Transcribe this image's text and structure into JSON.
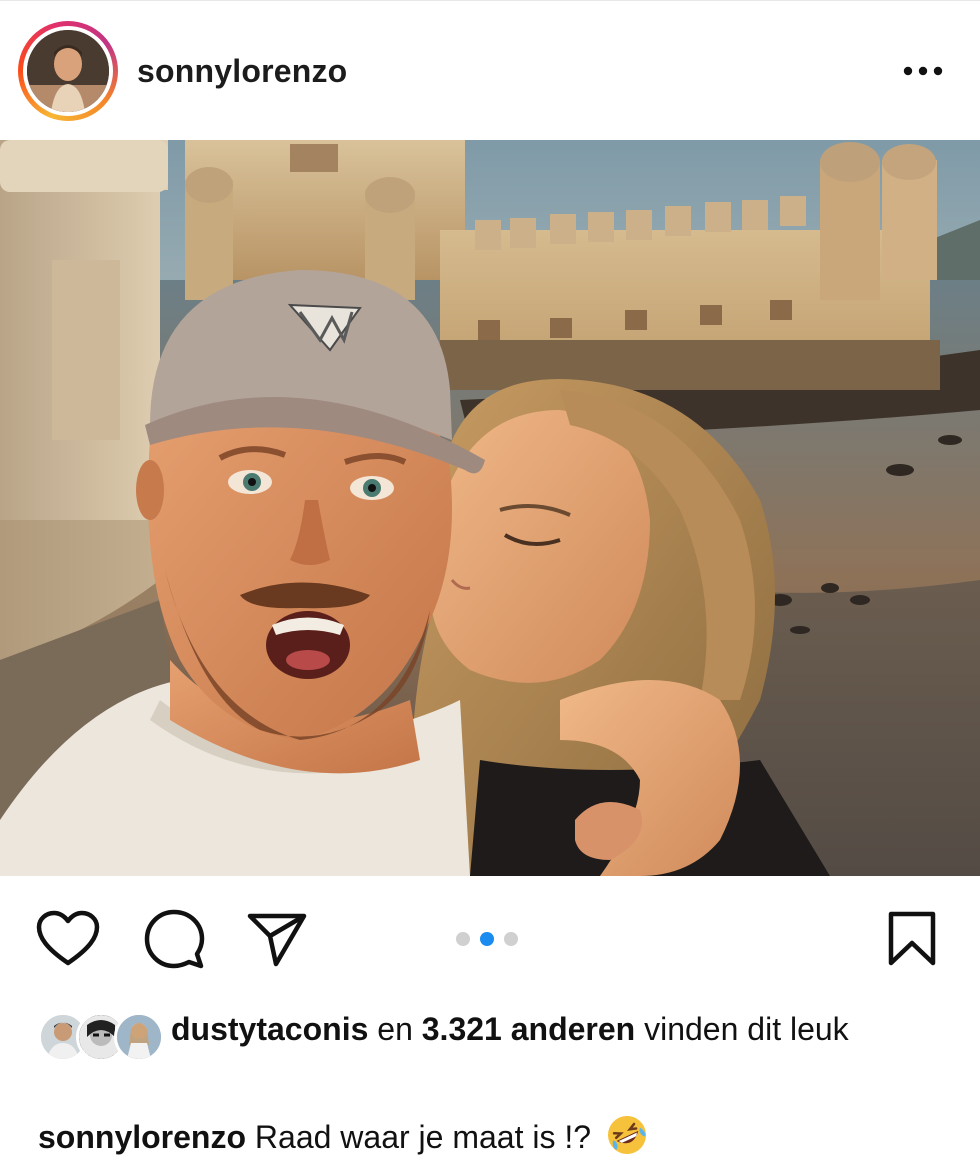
{
  "post": {
    "username": "sonnylorenzo",
    "more_icon": "more-horizontal-icon"
  },
  "photo": {
    "subject": "photo",
    "carousel": {
      "total": 3,
      "active_index": 1
    }
  },
  "actions": {
    "like_icon": "heart-icon",
    "comment_icon": "comment-icon",
    "share_icon": "send-icon",
    "save_icon": "bookmark-icon"
  },
  "likes": {
    "first_liker": "dustytaconis",
    "joiner": "en",
    "count_text": "3.321 anderen",
    "suffix": "vinden dit leuk"
  },
  "caption": {
    "username": "sonnylorenzo",
    "text": "Raad waar je maat is !?",
    "emoji": "rolling-on-the-floor-laughing-emoji"
  },
  "colors": {
    "accent_blue": "#1a8cf0",
    "text": "#111111",
    "dot_inactive": "#d0d0d0"
  }
}
